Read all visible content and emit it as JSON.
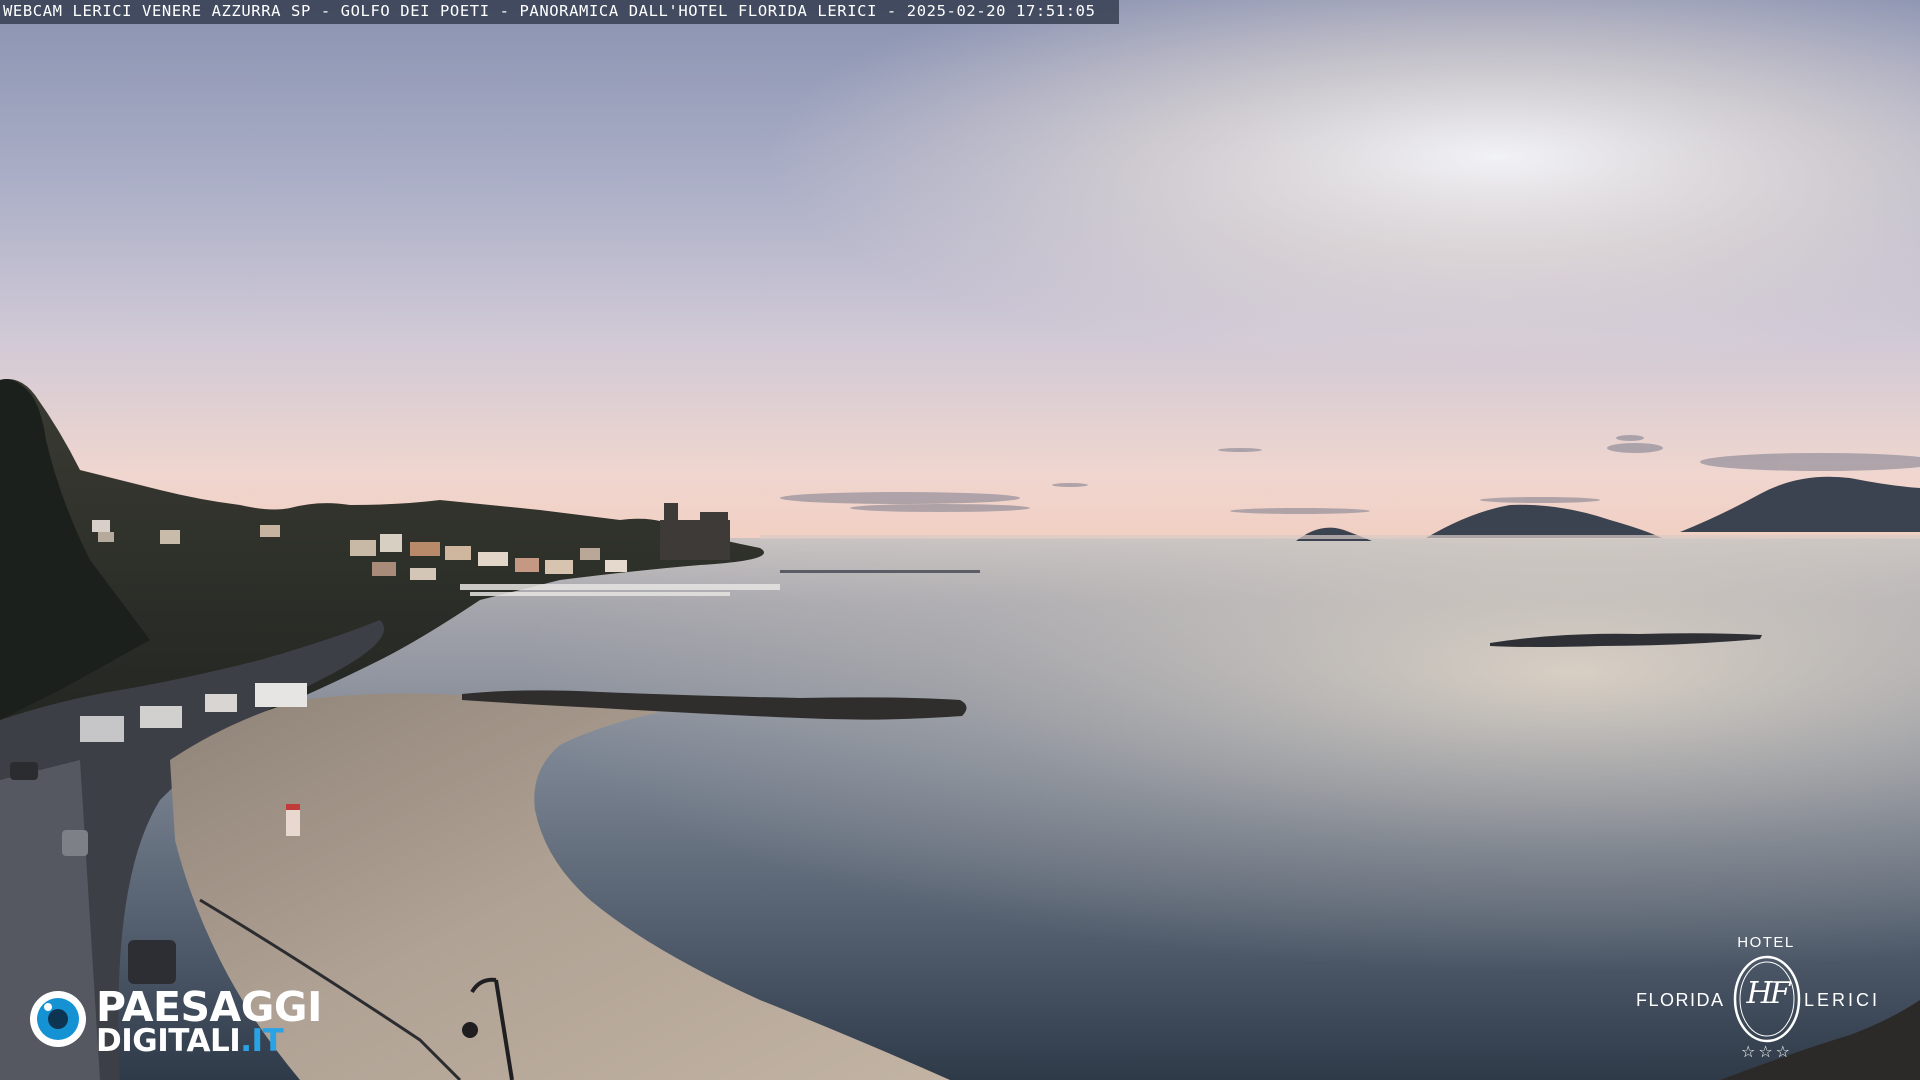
{
  "caption": "WEBCAM LERICI VENERE AZZURRA SP - GOLFO DEI POETI - PANORAMICA DALL'HOTEL FLORIDA LERICI - 2025-02-20 17:51:05",
  "logo_paesaggi": {
    "line1": "PAESAGGI",
    "line2_main": "DIGITALI",
    "line2_accent": ".IT"
  },
  "logo_hotel": {
    "top": "HOTEL",
    "left": "FLORIDA",
    "right": "LERICI",
    "monogram": "HF",
    "stars": "☆☆☆"
  },
  "colors": {
    "sky_top": "#8d96b4",
    "sky_mid": "#c3bdcf",
    "horizon_glow": "#f3d8c6",
    "sea_far": "#c9c2be",
    "sea_near": "#3b4858",
    "sand": "#a89a8c",
    "brand_blue": "#1592d4"
  }
}
